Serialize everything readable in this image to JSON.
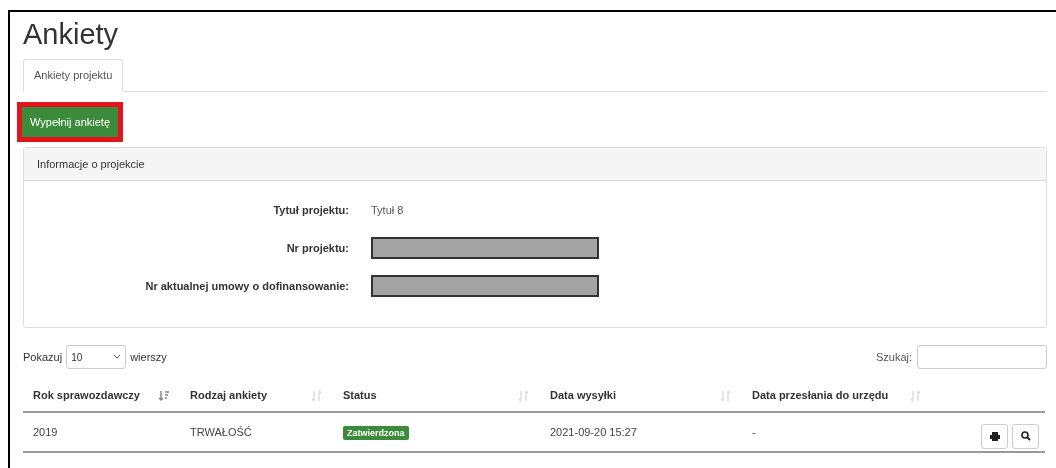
{
  "title": "Ankiety",
  "tabs": [
    {
      "label": "Ankiety projektu",
      "selected": true
    }
  ],
  "action_button": {
    "label": "Wypełnij ankietę",
    "highlighted": true
  },
  "info_panel": {
    "title": "Informacje o projekcie",
    "fields": [
      {
        "label": "Tytuł projektu:",
        "value": "Tytuł 8",
        "redacted": false
      },
      {
        "label": "Nr projektu:",
        "redacted": true
      },
      {
        "label": "Nr aktualnej umowy o dofinansowanie:",
        "redacted": true
      }
    ]
  },
  "table_controls": {
    "show_label": "Pokazuj",
    "page_size": "10",
    "rows_label": "wierszy",
    "search_label": "Szukaj:"
  },
  "table": {
    "columns": [
      {
        "label": "Rok sprawozdawczy",
        "sorted": true
      },
      {
        "label": "Rodzaj ankiety",
        "sorted": false
      },
      {
        "label": "Status",
        "sorted": false
      },
      {
        "label": "Data wysyłki",
        "sorted": false
      },
      {
        "label": "Data przesłania do urzędu",
        "sorted": false
      }
    ],
    "rows": [
      {
        "year": "2019",
        "type": "TRWAŁOŚĆ",
        "status": "Zatwierdzona",
        "sent": "2021-09-20 15:27",
        "submitted": "-"
      }
    ]
  }
}
